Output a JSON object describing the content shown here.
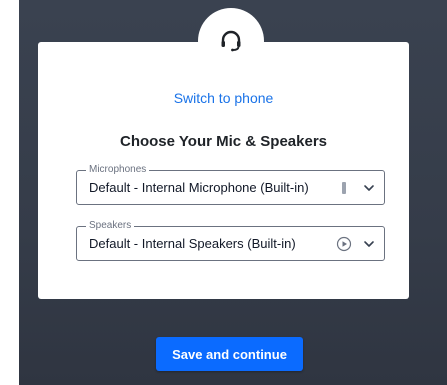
{
  "dialog": {
    "switch_link": "Switch to phone",
    "title": "Choose Your Mic & Speakers"
  },
  "microphones": {
    "legend": "Microphones",
    "value": "Default - Internal Microphone (Built-in)",
    "level_icon": "mic-level-icon"
  },
  "speakers": {
    "legend": "Speakers",
    "value": "Default - Internal Speakers (Built-in)",
    "test_icon": "play-icon"
  },
  "actions": {
    "save_label": "Save and continue"
  },
  "colors": {
    "accent": "#0b6bff",
    "link": "#1a73e8",
    "backdrop": "#3a4250"
  }
}
